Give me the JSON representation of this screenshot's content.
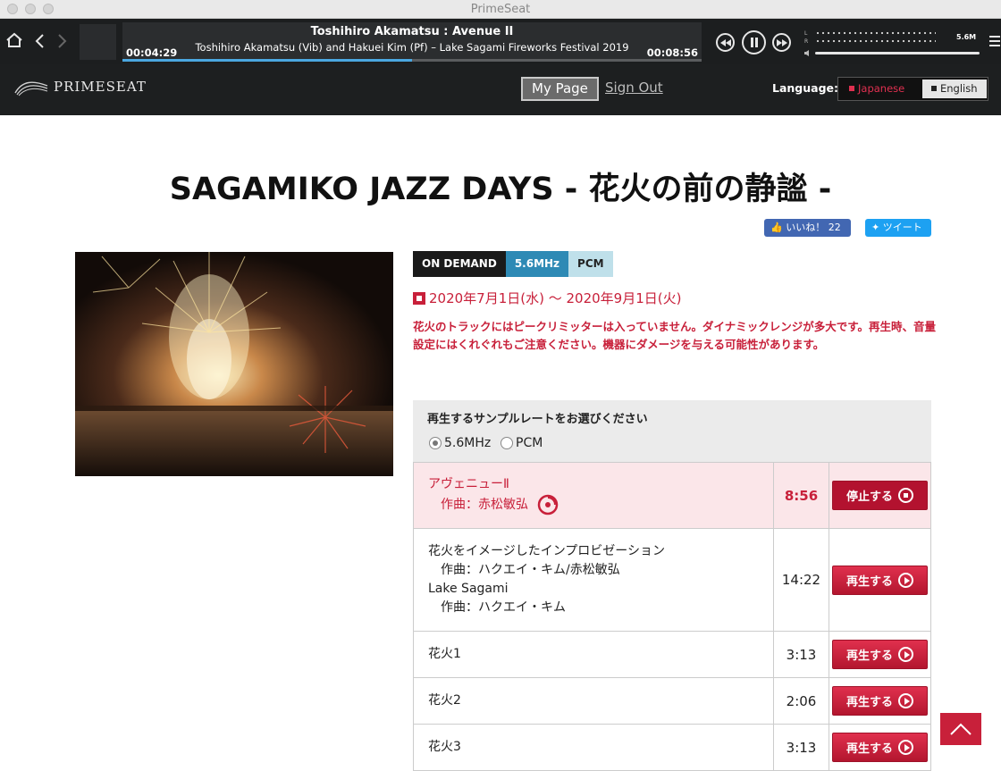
{
  "window": {
    "title": "PrimeSeat"
  },
  "player": {
    "track_title": "Toshihiro Akamatsu : Avenue II",
    "track_subtitle": "Toshihiro Akamatsu (Vib) and Hakuei Kim (Pf) – Lake Sagami Fireworks Festival 2019",
    "elapsed": "00:04:29",
    "duration": "00:08:56",
    "progress_fraction": 0.5,
    "meter_left_label": "L",
    "meter_right_label": "R",
    "sample_rate": "5.6M"
  },
  "header": {
    "logo_text": "PRIMESEAT",
    "my_page": "My Page",
    "sign_out": "Sign Out",
    "language_label": "Language:",
    "lang_japanese": "Japanese",
    "lang_english": "English"
  },
  "page": {
    "title": "SAGAMIKO JAZZ DAYS - 花火の前の静謐 -",
    "fb_like": "いいね！ 22",
    "tweet": "ツイート",
    "badges": [
      "ON DEMAND",
      "5.6MHz",
      "PCM"
    ],
    "date_range": "2020年7月1日(水) 〜 2020年9月1日(火)",
    "warning": "花火のトラックにはピークリミッターは入っていません。ダイナミックレンジが多大です。再生時、音量設定にはくれぐれもご注意ください。機器にダメージを与える可能性があります。"
  },
  "rate_select": {
    "label": "再生するサンプルレートをお選びください",
    "options": [
      "5.6MHz",
      "PCM"
    ],
    "selected": "5.6MHz"
  },
  "tracks": [
    {
      "lines": [
        "アヴェニューⅡ",
        "作曲：赤松敏弘"
      ],
      "duration": "8:56",
      "button": "停止する",
      "playing": true
    },
    {
      "lines": [
        "花火をイメージしたインプロビゼーション",
        "作曲：ハクエイ・キム/赤松敏弘",
        "Lake Sagami",
        "作曲：ハクエイ・キム"
      ],
      "duration": "14:22",
      "button": "再生する",
      "playing": false
    },
    {
      "lines": [
        "花火1"
      ],
      "duration": "3:13",
      "button": "再生する",
      "playing": false
    },
    {
      "lines": [
        "花火2"
      ],
      "duration": "2:06",
      "button": "再生する",
      "playing": false
    },
    {
      "lines": [
        "花火3"
      ],
      "duration": "3:13",
      "button": "再生する",
      "playing": false
    }
  ],
  "colors": {
    "accent": "#c8203a",
    "header_bg": "#1d1f20",
    "player_bg": "#1c1e1f",
    "progress": "#4ba7e0"
  }
}
